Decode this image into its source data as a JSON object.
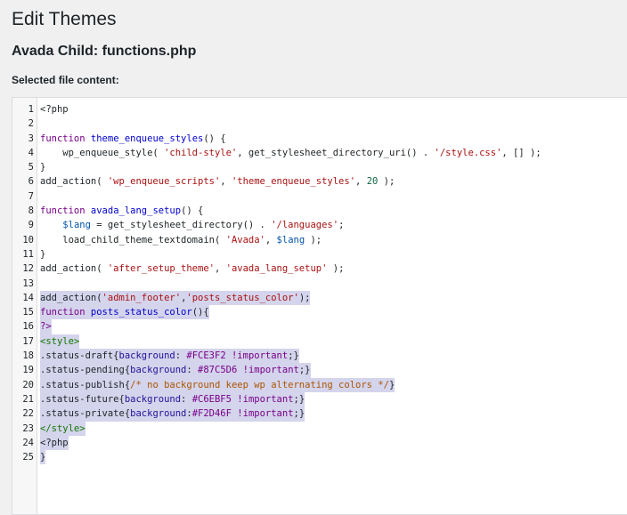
{
  "header": {
    "title": "Edit Themes",
    "file_title": "Avada Child: functions.php",
    "content_label": "Selected file content:"
  },
  "editor": {
    "selection_color": "#d4d4ec",
    "lines": [
      {
        "n": "1",
        "sel": false,
        "tokens": [
          [
            "",
            "<?php"
          ]
        ]
      },
      {
        "n": "2",
        "sel": false,
        "tokens": []
      },
      {
        "n": "3",
        "sel": false,
        "tokens": [
          [
            "kw",
            "function"
          ],
          [
            "",
            " "
          ],
          [
            "def",
            "theme_enqueue_styles"
          ],
          [
            "",
            "() {"
          ]
        ]
      },
      {
        "n": "4",
        "sel": false,
        "tokens": [
          [
            "",
            "    wp_enqueue_style( "
          ],
          [
            "str",
            "'child-style'"
          ],
          [
            "",
            ", get_stylesheet_directory_uri() . "
          ],
          [
            "str",
            "'/style.css'"
          ],
          [
            "",
            ", [] );"
          ]
        ]
      },
      {
        "n": "5",
        "sel": false,
        "tokens": [
          [
            "",
            "}"
          ]
        ]
      },
      {
        "n": "6",
        "sel": false,
        "tokens": [
          [
            "",
            "add_action( "
          ],
          [
            "str",
            "'wp_enqueue_scripts'"
          ],
          [
            "",
            ", "
          ],
          [
            "str",
            "'theme_enqueue_styles'"
          ],
          [
            "",
            ", "
          ],
          [
            "num",
            "20"
          ],
          [
            "",
            " );"
          ]
        ]
      },
      {
        "n": "7",
        "sel": false,
        "tokens": []
      },
      {
        "n": "8",
        "sel": false,
        "tokens": [
          [
            "kw",
            "function"
          ],
          [
            "",
            " "
          ],
          [
            "def",
            "avada_lang_setup"
          ],
          [
            "",
            "() {"
          ]
        ]
      },
      {
        "n": "9",
        "sel": false,
        "tokens": [
          [
            "",
            "    "
          ],
          [
            "var",
            "$lang"
          ],
          [
            "",
            " = get_stylesheet_directory() . "
          ],
          [
            "str",
            "'/languages'"
          ],
          [
            "",
            ";"
          ]
        ]
      },
      {
        "n": "10",
        "sel": false,
        "tokens": [
          [
            "",
            "    load_child_theme_textdomain( "
          ],
          [
            "str",
            "'Avada'"
          ],
          [
            "",
            ", "
          ],
          [
            "var",
            "$lang"
          ],
          [
            "",
            " );"
          ]
        ]
      },
      {
        "n": "11",
        "sel": false,
        "tokens": [
          [
            "",
            "}"
          ]
        ]
      },
      {
        "n": "12",
        "sel": false,
        "tokens": [
          [
            "",
            "add_action( "
          ],
          [
            "str",
            "'after_setup_theme'"
          ],
          [
            "",
            ", "
          ],
          [
            "str",
            "'avada_lang_setup'"
          ],
          [
            "",
            " );"
          ]
        ]
      },
      {
        "n": "13",
        "sel": false,
        "tokens": []
      },
      {
        "n": "14",
        "sel": true,
        "tokens": [
          [
            "",
            "add_action("
          ],
          [
            "str",
            "'admin_footer'"
          ],
          [
            "",
            ","
          ],
          [
            "str",
            "'posts_status_color'"
          ],
          [
            "",
            ");"
          ]
        ]
      },
      {
        "n": "15",
        "sel": true,
        "tokens": [
          [
            "kw",
            "function"
          ],
          [
            "",
            " "
          ],
          [
            "def",
            "posts_status_color"
          ],
          [
            "",
            "(){"
          ]
        ]
      },
      {
        "n": "16",
        "sel": true,
        "tokens": [
          [
            "kw",
            "?>"
          ]
        ]
      },
      {
        "n": "17",
        "sel": true,
        "tokens": [
          [
            "tag",
            "<style>"
          ]
        ]
      },
      {
        "n": "18",
        "sel": true,
        "tokens": [
          [
            "",
            "."
          ],
          [
            "",
            "status-draft{"
          ],
          [
            "prop",
            "background"
          ],
          [
            "",
            ": "
          ],
          [
            "kw",
            "#FCE3F2"
          ],
          [
            "",
            " "
          ],
          [
            "imp",
            "!important"
          ],
          [
            "",
            ";}"
          ]
        ]
      },
      {
        "n": "19",
        "sel": true,
        "tokens": [
          [
            "",
            ".status-pending{"
          ],
          [
            "prop",
            "background"
          ],
          [
            "",
            ": "
          ],
          [
            "kw",
            "#87C5D6"
          ],
          [
            "",
            " "
          ],
          [
            "imp",
            "!important"
          ],
          [
            "",
            ";}"
          ]
        ]
      },
      {
        "n": "20",
        "sel": true,
        "tokens": [
          [
            "",
            ".status-publish{"
          ],
          [
            "cmt",
            "/* no background keep wp alternating colors */"
          ],
          [
            "",
            "}"
          ]
        ]
      },
      {
        "n": "21",
        "sel": true,
        "tokens": [
          [
            "",
            ".status-future{"
          ],
          [
            "prop",
            "background"
          ],
          [
            "",
            ": "
          ],
          [
            "kw",
            "#C6EBF5"
          ],
          [
            "",
            " "
          ],
          [
            "imp",
            "!important"
          ],
          [
            "",
            ";}"
          ]
        ]
      },
      {
        "n": "22",
        "sel": true,
        "tokens": [
          [
            "",
            ".status-private{"
          ],
          [
            "prop",
            "background"
          ],
          [
            "",
            ":"
          ],
          [
            "kw",
            "#F2D46F"
          ],
          [
            "",
            " "
          ],
          [
            "imp",
            "!important"
          ],
          [
            "",
            ";}"
          ]
        ]
      },
      {
        "n": "23",
        "sel": true,
        "tokens": [
          [
            "tag",
            "</style>"
          ]
        ]
      },
      {
        "n": "24",
        "sel": true,
        "tokens": [
          [
            "",
            "<?php"
          ]
        ]
      },
      {
        "n": "25",
        "sel": true,
        "tokens": [
          [
            "",
            "}"
          ]
        ]
      }
    ]
  }
}
